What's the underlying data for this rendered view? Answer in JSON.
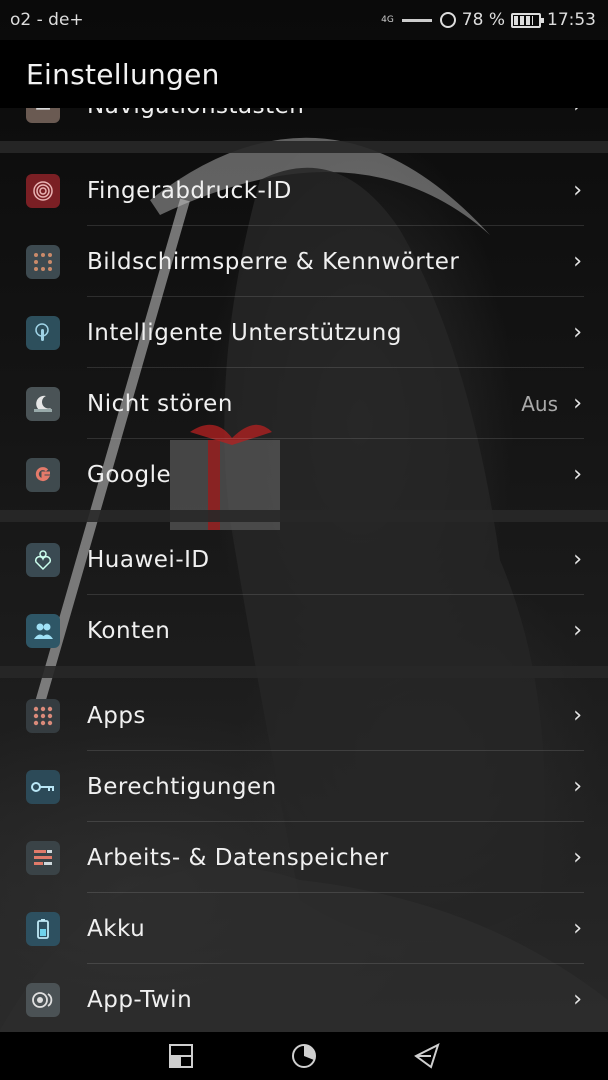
{
  "status_bar": {
    "carrier": "o2 - de+",
    "network": "4G",
    "battery_percent": "78 %",
    "battery_level": 0.78,
    "time": "17:53"
  },
  "header": {
    "title": "Einstellungen"
  },
  "items": [
    {
      "label": "Navigationstasten",
      "icon": "navigation-keys-icon"
    },
    {
      "label": "Fingerabdruck-ID",
      "icon": "fingerprint-icon"
    },
    {
      "label": "Bildschirmsperre & Kennwörter",
      "icon": "lock-pattern-icon"
    },
    {
      "label": "Intelligente Unterstützung",
      "icon": "touch-hand-icon"
    },
    {
      "label": "Nicht stören",
      "value": "Aus",
      "icon": "moon-icon"
    },
    {
      "label": "Google",
      "icon": "google-icon"
    },
    {
      "label": "Huawei-ID",
      "icon": "huawei-id-icon"
    },
    {
      "label": "Konten",
      "icon": "accounts-icon"
    },
    {
      "label": "Apps",
      "icon": "apps-grid-icon"
    },
    {
      "label": "Berechtigungen",
      "icon": "key-icon"
    },
    {
      "label": "Arbeits- & Datenspeicher",
      "icon": "storage-icon"
    },
    {
      "label": "Akku",
      "icon": "battery-icon"
    },
    {
      "label": "App-Twin",
      "icon": "app-twin-icon"
    }
  ],
  "chevron": "›",
  "navbar": {
    "back": "back-icon",
    "home": "home-icon",
    "recents": "recents-icon"
  }
}
